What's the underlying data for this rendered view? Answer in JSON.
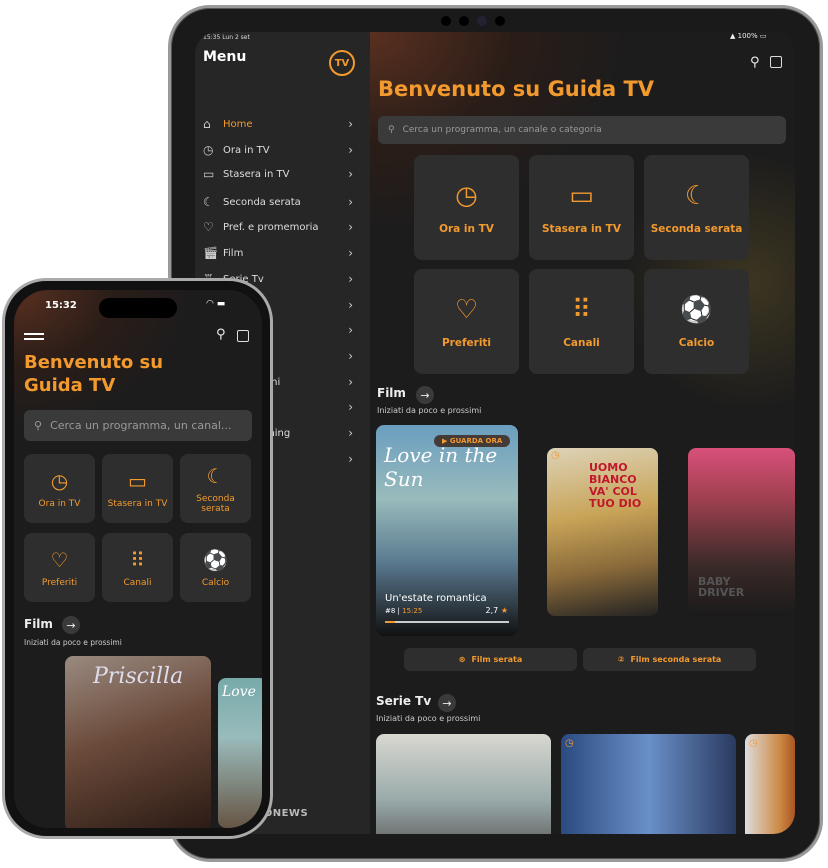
{
  "tablet": {
    "status": {
      "time_date": "15:35  Lun 2 set",
      "battery": "100%"
    },
    "menu": {
      "title": "Menu",
      "logo_text": "Guida TV",
      "items": [
        {
          "label": "Home",
          "icon": "home-icon",
          "active": true
        },
        {
          "label": "Ora in TV",
          "icon": "clock-icon"
        },
        {
          "label": "Stasera in TV",
          "icon": "tv-icon"
        },
        {
          "label": "Seconda serata",
          "icon": "moon-icon"
        },
        {
          "label": "Pref. e promemoria",
          "icon": "heart-icon"
        },
        {
          "label": "Film",
          "icon": "clapperboard-icon"
        },
        {
          "label": "Serie Tv",
          "icon": "popcorn-icon"
        },
        {
          "label": ""
        },
        {
          "label": ""
        },
        {
          "label": ""
        },
        {
          "label": "oni"
        },
        {
          "label": ""
        },
        {
          "label": "ming"
        },
        {
          "label": ""
        }
      ]
    },
    "title": "Benvenuto su Guida TV",
    "search_placeholder": "Cerca un programma, un canale o categoria",
    "tiles": [
      {
        "label": "Ora in TV",
        "icon": "clock-icon"
      },
      {
        "label": "Stasera in TV",
        "icon": "tv-icon"
      },
      {
        "label": "Seconda serata",
        "icon": "moon-icon"
      },
      {
        "label": "Preferiti",
        "icon": "heart-icon"
      },
      {
        "label": "Canali",
        "icon": "grid-dots-icon"
      },
      {
        "label": "Calcio",
        "icon": "soccer-ball-icon"
      }
    ],
    "film": {
      "title": "Film",
      "subtitle": "Iniziati da poco e prossimi",
      "featured": {
        "badge": "GUARDA ORA",
        "poster_text": "Love in the Sun",
        "title": "Un'estate romantica",
        "channel": "#8",
        "time": "15:25",
        "rating": "2,7",
        "progress": 0.08
      },
      "poster2_text": "UOMO BIANCO VA' COL TUO DIO",
      "poster3_text": "BABY DRIVER",
      "buttons": [
        "Film serata",
        "Film seconda serata"
      ]
    },
    "serie": {
      "title": "Serie Tv",
      "subtitle": "Iniziati da poco e prossimi"
    },
    "watermark": "CNONEWS"
  },
  "phone": {
    "status": {
      "time": "15:32"
    },
    "title": "Benvenuto su Guida TV",
    "search_placeholder": "Cerca un programma, un canal...",
    "tiles": [
      {
        "label": "Ora in TV"
      },
      {
        "label": "Stasera in TV"
      },
      {
        "label": "Seconda serata"
      },
      {
        "label": "Preferiti"
      },
      {
        "label": "Canali"
      },
      {
        "label": "Calcio"
      }
    ],
    "film": {
      "title": "Film",
      "subtitle": "Iniziati da poco e prossimi",
      "poster_text": "Priscilla",
      "poster2_text": "Love"
    }
  },
  "colors": {
    "accent": "#f39a2e",
    "background": "#1f1f1f",
    "tile": "#2e2e2e"
  }
}
